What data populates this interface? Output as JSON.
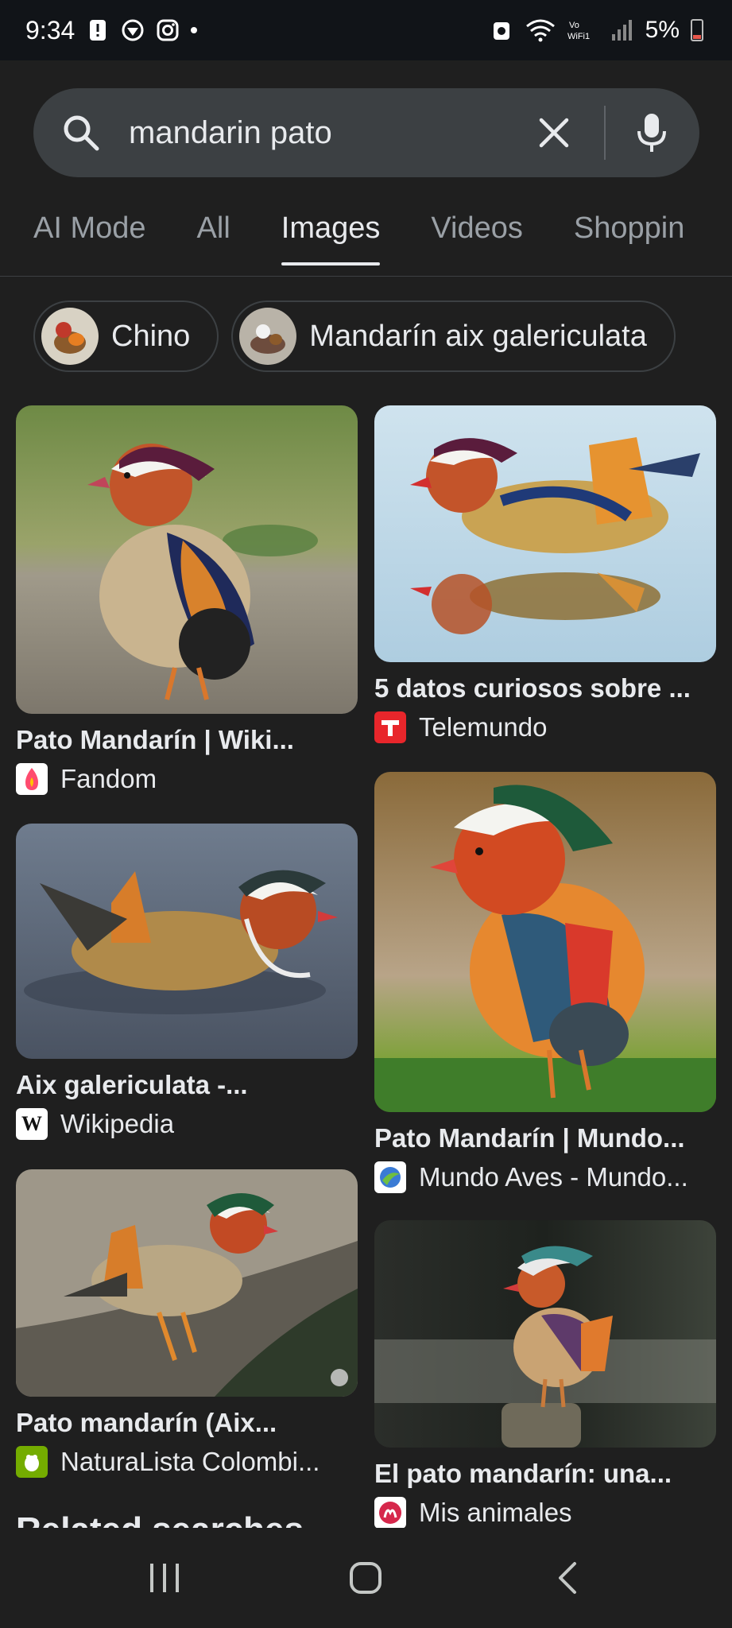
{
  "status_bar": {
    "time": "9:34",
    "battery": "5%"
  },
  "search": {
    "query": "mandarin pato"
  },
  "tabs": [
    {
      "label": "AI Mode",
      "active": false
    },
    {
      "label": "All",
      "active": false
    },
    {
      "label": "Images",
      "active": true
    },
    {
      "label": "Videos",
      "active": false
    },
    {
      "label": "Shoppin",
      "active": false
    }
  ],
  "chips": [
    {
      "label": "Chino"
    },
    {
      "label": "Mandarín aix galericulata"
    }
  ],
  "results": [
    {
      "title": "Pato Mandarín | Wiki...",
      "source": "Fandom",
      "favicon_color": "#ff4b6e"
    },
    {
      "title": "5 datos curiosos sobre ...",
      "source": "Telemundo",
      "favicon_color": "#e8262b"
    },
    {
      "title": "Aix galericulata -...",
      "source": "Wikipedia",
      "favicon_color": "#ffffff"
    },
    {
      "title": "Pato Mandarín | Mundo...",
      "source": "Mundo Aves - Mundo...",
      "favicon_color": "#ffffff"
    },
    {
      "title": "Pato mandarín (Aix...",
      "source": "NaturaLista Colombi...",
      "favicon_color": "#74ac00"
    },
    {
      "title": "El pato mandarín: una...",
      "source": "Mis animales",
      "favicon_color": "#d6274b"
    }
  ],
  "related_heading": "Related searches"
}
